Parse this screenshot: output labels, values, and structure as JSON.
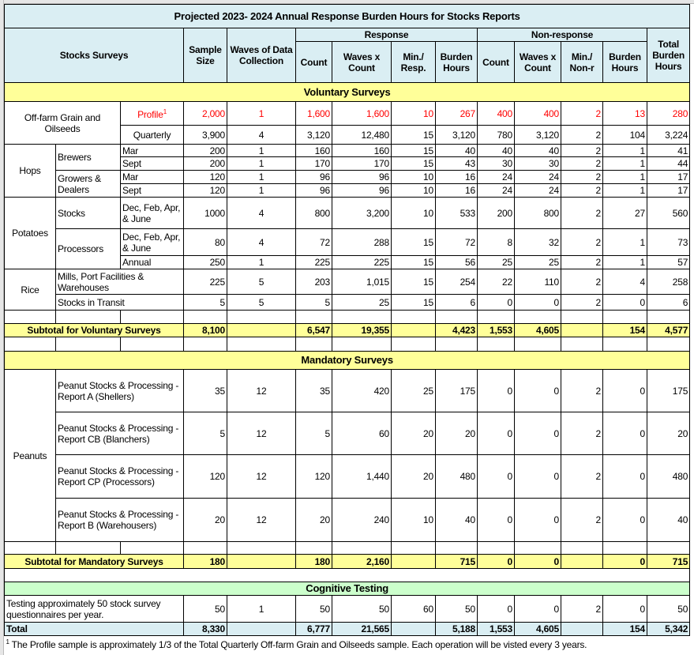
{
  "title": "Projected 2023- 2024 Annual Response Burden Hours for Stocks Reports",
  "headers": {
    "stocks_surveys": "Stocks Surveys",
    "sample_size": "Sample Size",
    "waves": "Waves of Data Collection",
    "response": "Response",
    "nonresponse": "Non-response",
    "total": "Total Burden Hours",
    "r_count": "Count",
    "r_wxc": "Waves x Count",
    "r_min": "Min./ Resp.",
    "r_burden": "Burden Hours",
    "n_count": "Count",
    "n_wxc": "Waves x Count",
    "n_min": "Min./ Non-r",
    "n_burden": "Burden Hours"
  },
  "voluntary": {
    "label": "Voluntary Surveys",
    "rows": [
      {
        "group": "Off-farm Grain and Oilseeds",
        "label": "Profile",
        "sup": "1",
        "vals": [
          "2,000",
          "1",
          "1,600",
          "1,600",
          "10",
          "267",
          "400",
          "400",
          "2",
          "13",
          "280"
        ]
      },
      {
        "label": "Quarterly",
        "vals": [
          "3,900",
          "4",
          "3,120",
          "12,480",
          "15",
          "3,120",
          "780",
          "3,120",
          "2",
          "104",
          "3,224"
        ]
      },
      {
        "group": "Hops",
        "sub": "Brewers",
        "label": "Mar",
        "vals": [
          "200",
          "1",
          "160",
          "160",
          "15",
          "40",
          "40",
          "40",
          "2",
          "1",
          "41"
        ]
      },
      {
        "label": "Sept",
        "vals": [
          "200",
          "1",
          "170",
          "170",
          "15",
          "43",
          "30",
          "30",
          "2",
          "1",
          "44"
        ]
      },
      {
        "sub": "Growers & Dealers",
        "label": "Mar",
        "vals": [
          "120",
          "1",
          "96",
          "96",
          "10",
          "16",
          "24",
          "24",
          "2",
          "1",
          "17"
        ]
      },
      {
        "label": "Sept",
        "vals": [
          "120",
          "1",
          "96",
          "96",
          "10",
          "16",
          "24",
          "24",
          "2",
          "1",
          "17"
        ]
      },
      {
        "group": "Potatoes",
        "sub": "Stocks",
        "label": "Dec, Feb, Apr, & June",
        "vals": [
          "1000",
          "4",
          "800",
          "3,200",
          "10",
          "533",
          "200",
          "800",
          "2",
          "27",
          "560"
        ]
      },
      {
        "sub": "Processors",
        "label": "Dec, Feb, Apr, & June",
        "vals": [
          "80",
          "4",
          "72",
          "288",
          "15",
          "72",
          "8",
          "32",
          "2",
          "1",
          "73"
        ]
      },
      {
        "label": "Annual",
        "vals": [
          "250",
          "1",
          "225",
          "225",
          "15",
          "56",
          "25",
          "25",
          "2",
          "1",
          "57"
        ]
      },
      {
        "group": "Rice",
        "label": "Mills, Port Facilities & Warehouses",
        "vals": [
          "225",
          "5",
          "203",
          "1,015",
          "15",
          "254",
          "22",
          "110",
          "2",
          "4",
          "258"
        ]
      },
      {
        "label": "Stocks in Transit",
        "vals": [
          "5",
          "5",
          "5",
          "25",
          "15",
          "6",
          "0",
          "0",
          "2",
          "0",
          "6"
        ]
      }
    ],
    "subtotal": {
      "label": "Subtotal for Voluntary Surveys",
      "vals": [
        "8,100",
        "",
        "6,547",
        "19,355",
        "",
        "4,423",
        "1,553",
        "4,605",
        "",
        "154",
        "4,577"
      ]
    }
  },
  "mandatory": {
    "label": "Mandatory Surveys",
    "group": "Peanuts",
    "rows": [
      {
        "label": "Peanut Stocks & Processing - Report A (Shellers)",
        "vals": [
          "35",
          "12",
          "35",
          "420",
          "25",
          "175",
          "0",
          "0",
          "2",
          "0",
          "175"
        ]
      },
      {
        "label": "Peanut Stocks & Processing - Report CB (Blanchers)",
        "vals": [
          "5",
          "12",
          "5",
          "60",
          "20",
          "20",
          "0",
          "0",
          "2",
          "0",
          "20"
        ]
      },
      {
        "label": "Peanut Stocks & Processing - Report CP (Processors)",
        "vals": [
          "120",
          "12",
          "120",
          "1,440",
          "20",
          "480",
          "0",
          "0",
          "2",
          "0",
          "480"
        ]
      },
      {
        "label": "Peanut Stocks & Processing - Report B (Warehousers)",
        "vals": [
          "20",
          "12",
          "20",
          "240",
          "10",
          "40",
          "0",
          "0",
          "2",
          "0",
          "40"
        ]
      }
    ],
    "subtotal": {
      "label": "Subtotal for Mandatory Surveys",
      "vals": [
        "180",
        "",
        "180",
        "2,160",
        "",
        "715",
        "0",
        "0",
        "",
        "0",
        "715"
      ]
    }
  },
  "cognitive": {
    "label": "Cognitive Testing",
    "rows": [
      {
        "label": "Testing approximately 50 stock survey questionnaires per year.",
        "vals": [
          "50",
          "1",
          "50",
          "50",
          "60",
          "50",
          "0",
          "0",
          "2",
          "0",
          "50"
        ]
      }
    ]
  },
  "total": {
    "label": "Total",
    "vals": [
      "8,330",
      "",
      "6,777",
      "21,565",
      "",
      "5,188",
      "1,553",
      "4,605",
      "",
      "154",
      "5,342"
    ]
  },
  "footnote": {
    "sup": "1",
    "text": " The Profile sample is approximately 1/3 of the Total Quarterly Off-farm Grain and Oilseeds sample. Each operation will be visted every 3 years."
  },
  "colors": {
    "header": "#daeef3",
    "section": "#ffff99",
    "cognitive": "#ccffcc",
    "highlight": "#ff0000"
  }
}
